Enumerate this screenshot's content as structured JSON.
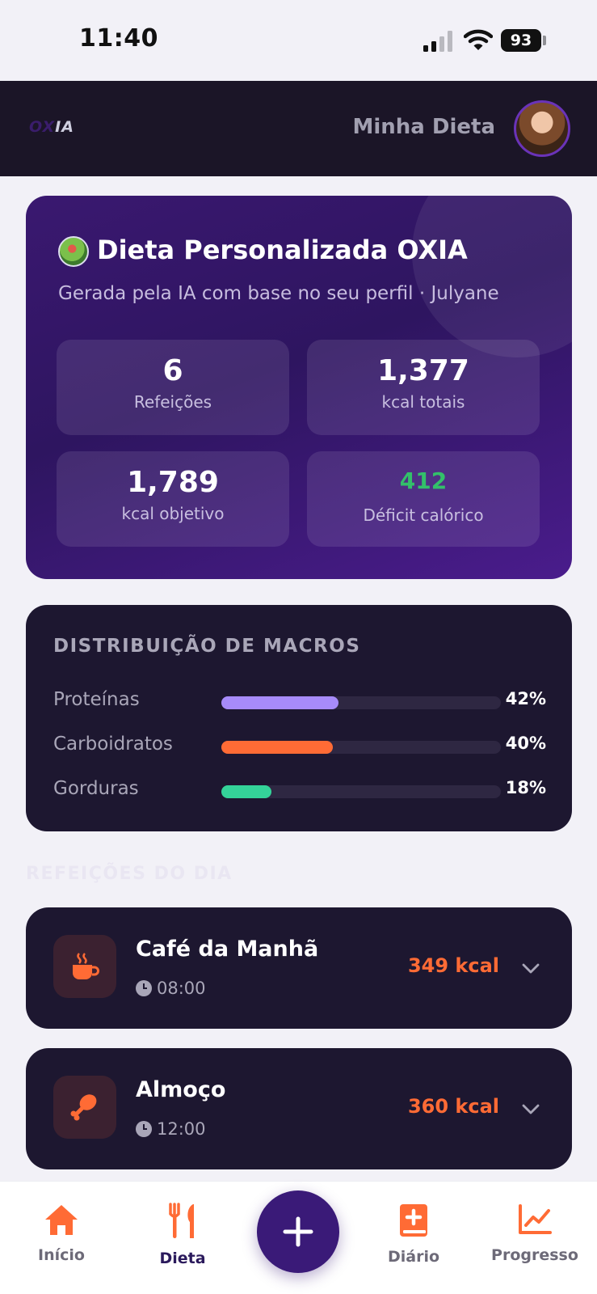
{
  "status_bar": {
    "time": "11:40",
    "battery": "93"
  },
  "header": {
    "logo": "OXIA",
    "logo_dim": "OX",
    "logo_bright": "IA",
    "title": "Minha Dieta"
  },
  "hero": {
    "title": "Dieta Personalizada OXIA",
    "subtitle": "Gerada pela IA com base no seu perfil · Julyane",
    "stats": [
      {
        "value": "6",
        "label": "Refeições"
      },
      {
        "value": "1,377",
        "label": "kcal totais"
      },
      {
        "value": "1,789",
        "label": "kcal objetivo"
      },
      {
        "value": "412",
        "label": "Déficit calórico"
      }
    ]
  },
  "macros": {
    "title": "DISTRIBUIÇÃO DE MACROS",
    "items": [
      {
        "name": "Proteínas",
        "pct_label": "42%",
        "value": 0.42,
        "color": "#a78bfa"
      },
      {
        "name": "Carboidratos",
        "pct_label": "40%",
        "value": 0.4,
        "color": "#ff6b35"
      },
      {
        "name": "Gorduras",
        "pct_label": "18%",
        "value": 0.18,
        "color": "#34d399"
      }
    ]
  },
  "meals_section": {
    "label": "REFEIÇÕES DO DIA"
  },
  "meals": [
    {
      "name": "Café da Manhã",
      "time": "08:00",
      "kcal": "349 kcal",
      "icon": "coffee-icon"
    },
    {
      "name": "Almoço",
      "time": "12:00",
      "kcal": "360 kcal",
      "icon": "drumstick-icon"
    }
  ],
  "accent_color": "#ff6b35",
  "nav": {
    "items": [
      {
        "label": "Início",
        "icon": "home-icon"
      },
      {
        "label": "Dieta",
        "icon": "utensils-icon"
      },
      {
        "label": "Diário",
        "icon": "book-plus-icon"
      },
      {
        "label": "Progresso",
        "icon": "chart-line-icon"
      }
    ],
    "fab_icon": "plus-icon"
  }
}
